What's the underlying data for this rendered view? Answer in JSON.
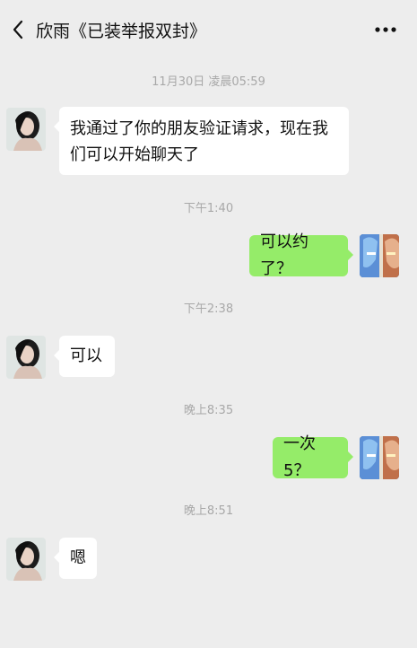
{
  "header": {
    "title": "欣雨《已装举报双封》",
    "back_icon": "chevron-left-icon",
    "more_icon": "more-dots-icon"
  },
  "messages": [
    {
      "kind": "time",
      "text": "11月30日 凌晨05:59"
    },
    {
      "kind": "msg",
      "side": "in",
      "text": "我通过了你的朋友验证请求，现在我们可以开始聊天了"
    },
    {
      "kind": "time",
      "text": "下午1:40"
    },
    {
      "kind": "msg",
      "side": "out",
      "text": "可以约了？"
    },
    {
      "kind": "time",
      "text": "下午2:38"
    },
    {
      "kind": "msg",
      "side": "in",
      "text": "可以"
    },
    {
      "kind": "time",
      "text": "晚上8:35"
    },
    {
      "kind": "msg",
      "side": "out",
      "text": "一次 5？"
    },
    {
      "kind": "time",
      "text": "晚上8:51"
    },
    {
      "kind": "msg",
      "side": "in",
      "text": "嗯"
    }
  ],
  "colors": {
    "background": "#ededed",
    "incoming_bubble": "#ffffff",
    "outgoing_bubble": "#95ec69",
    "timestamp": "#a8a8a8"
  }
}
